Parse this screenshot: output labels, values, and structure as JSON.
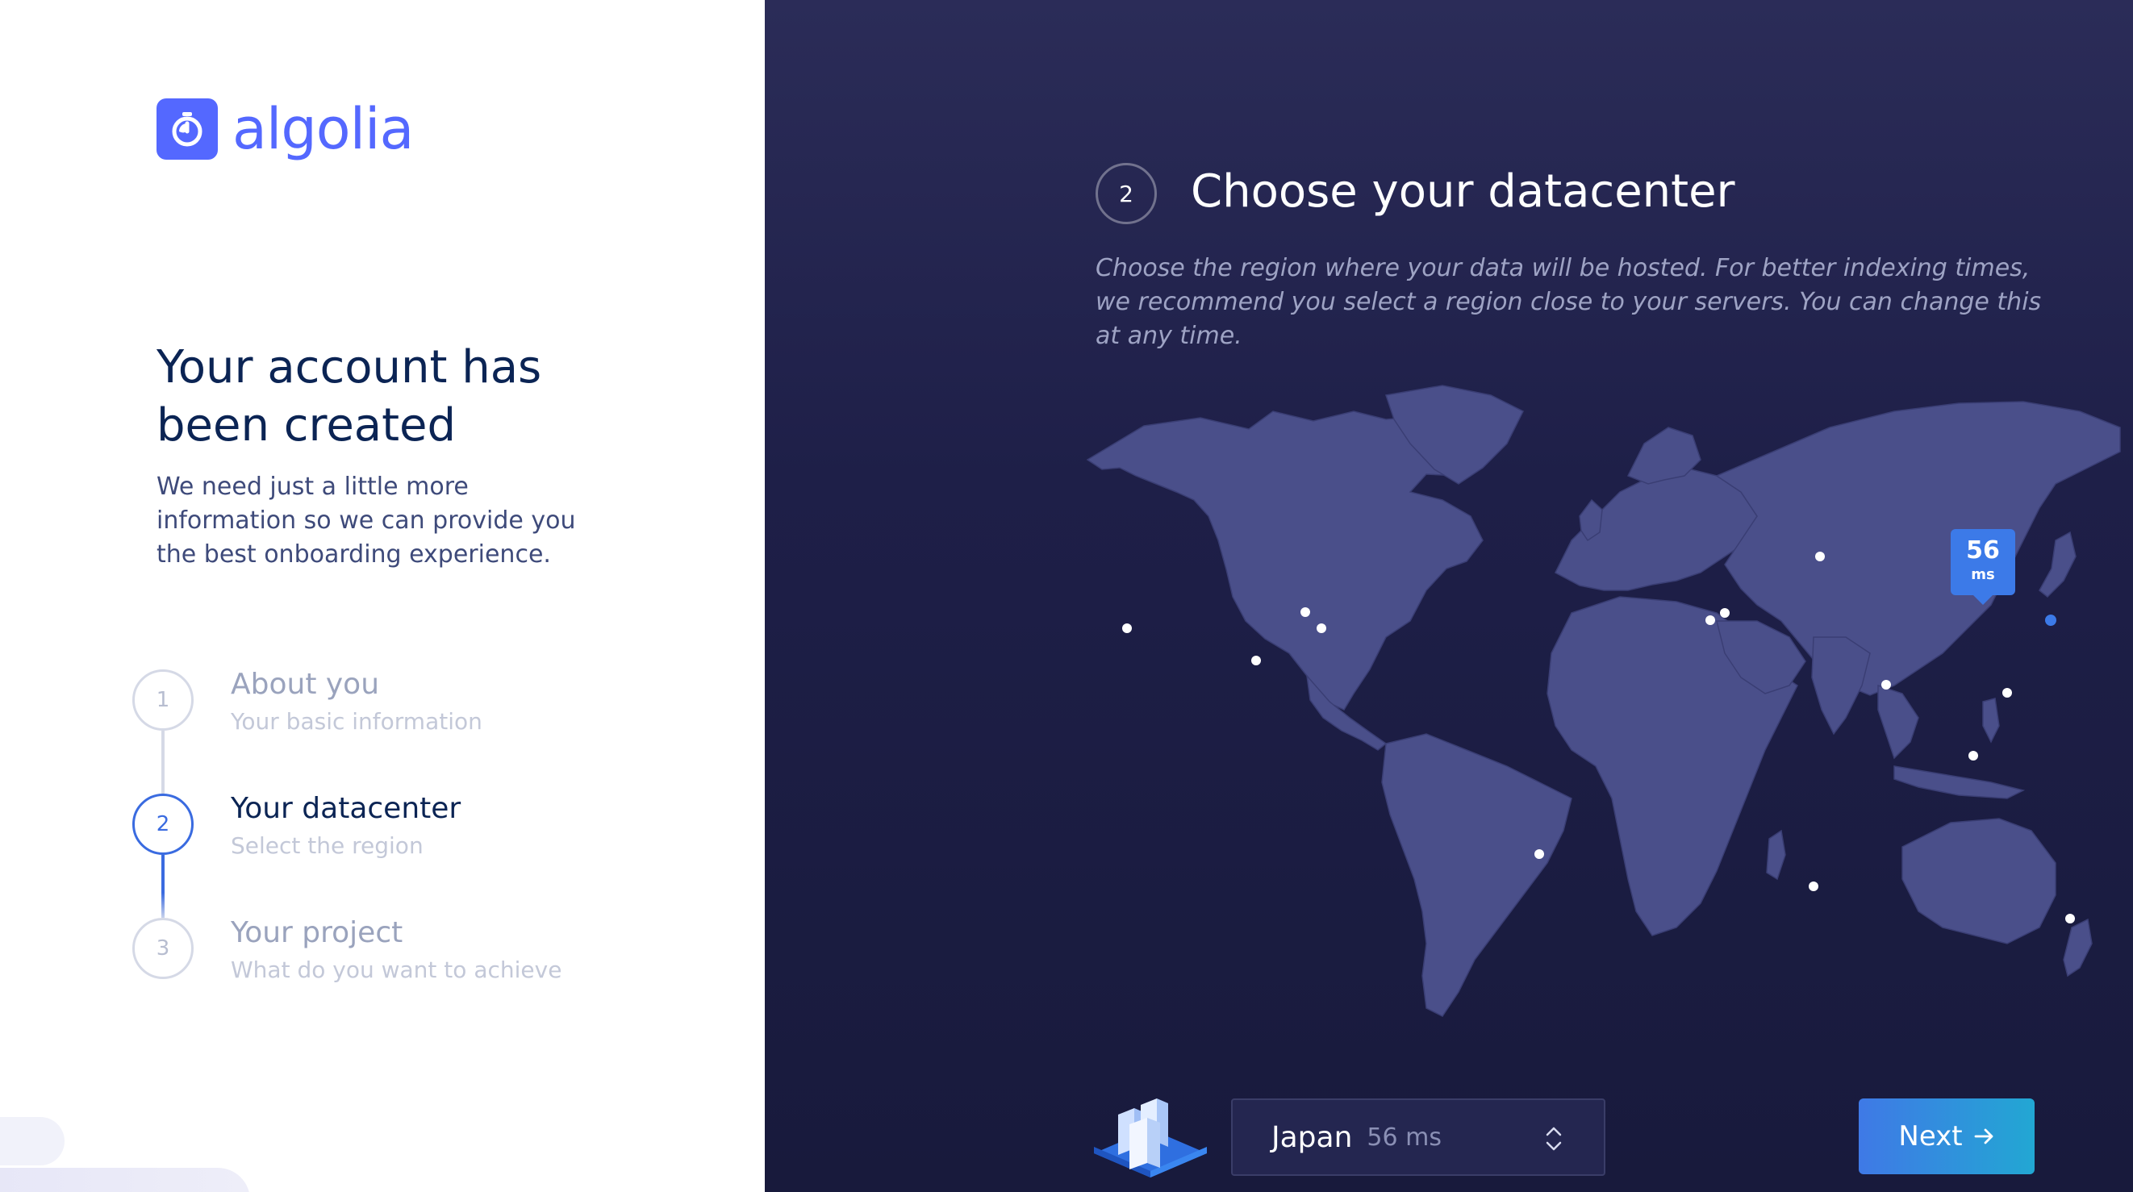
{
  "brand": {
    "name": "algolia",
    "color": "#5468ff"
  },
  "left": {
    "headline_line1": "Your account has",
    "headline_line2": "been created",
    "intro": "We need just a little more information so we can provide you the best onboarding experience."
  },
  "steps": [
    {
      "number": "1",
      "title": "About you",
      "subtitle": "Your basic information",
      "state": "done"
    },
    {
      "number": "2",
      "title": "Your datacenter",
      "subtitle": "Select the region",
      "state": "active"
    },
    {
      "number": "3",
      "title": "Your project",
      "subtitle": "What do you want to achieve",
      "state": "todo"
    }
  ],
  "main": {
    "step_number": "2",
    "title": "Choose your datacenter",
    "description": "Choose the region where your data will be hosted. For better indexing times, we recommend you select a region close to your servers. You can change this at any time."
  },
  "map": {
    "selected_latency_value": "56",
    "selected_latency_unit": "ms",
    "datacenter_marker_color": "#ffffff",
    "selected_marker_color": "#3c7ae8"
  },
  "footer": {
    "region_name": "Japan",
    "region_latency": "56 ms",
    "next_label": "Next"
  },
  "colors": {
    "panel_bg": "#1e1f48",
    "land": "#4a4f8a",
    "accent": "#3c7ae8"
  }
}
